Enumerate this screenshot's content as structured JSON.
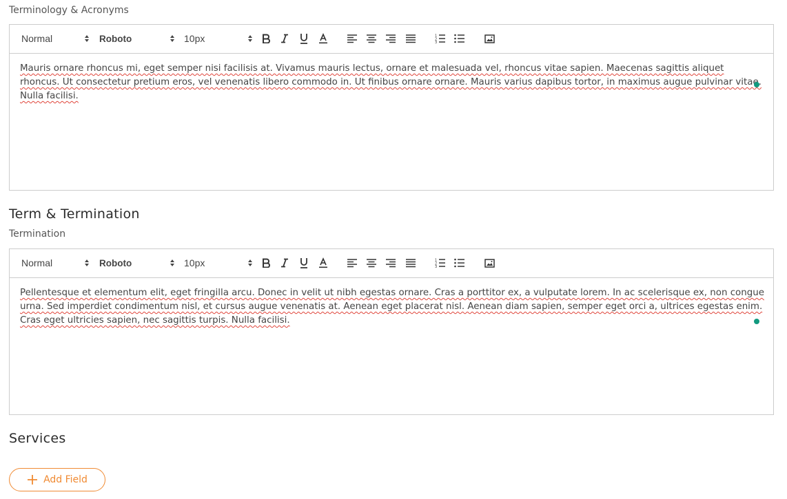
{
  "colors": {
    "accent_orange": "#f08a32",
    "status_green": "#129a7f",
    "spell_red": "#e0443a",
    "border": "#cccccc"
  },
  "sections": [
    {
      "field_label": "Terminology & Acronyms",
      "editor": {
        "toolbar": {
          "format": "Normal",
          "font": "Roboto",
          "size": "10px"
        },
        "content": "Mauris ornare rhoncus mi, eget semper nisi facilisis at. Vivamus mauris lectus, ornare et malesuada vel, rhoncus vitae sapien. Maecenas sagittis aliquet rhoncus. Ut consectetur pretium eros, vel venenatis libero commodo in. Ut finibus ornare ornare. Mauris varius dapibus tortor, in maximus augue pulvinar vitae. Nulla facilisi."
      }
    },
    {
      "heading": "Term & Termination",
      "field_label": "Termination",
      "editor": {
        "toolbar": {
          "format": "Normal",
          "font": "Roboto",
          "size": "10px"
        },
        "content": "Pellentesque et elementum elit, eget fringilla arcu. Donec in velit ut nibh egestas ornare. Cras a porttitor ex, a vulputate lorem. In ac scelerisque ex, non congue urna. Sed imperdiet condimentum nisl, et cursus augue venenatis at. Aenean eget placerat nisl. Aenean diam sapien, semper eget orci a, ultrices egestas enim. Cras eget ultricies sapien, nec sagittis turpis. Nulla facilisi."
      }
    },
    {
      "heading": "Services"
    }
  ],
  "add_field": {
    "icon": "plus-icon",
    "label": "Add Field"
  },
  "toolbar_icons": [
    "bold-icon",
    "italic-icon",
    "underline-icon",
    "text-color-icon",
    "align-left-icon",
    "align-center-icon",
    "align-right-icon",
    "align-justify-icon",
    "ordered-list-icon",
    "bullet-list-icon",
    "image-icon"
  ]
}
